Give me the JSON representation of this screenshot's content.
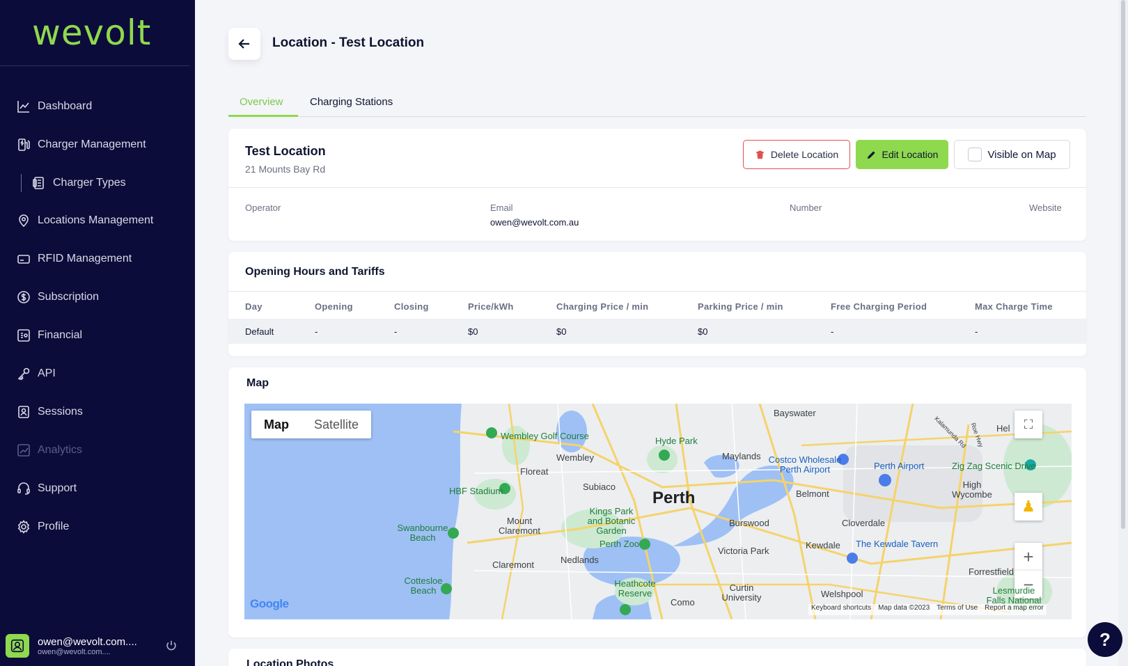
{
  "app": {
    "logo": "wevolt"
  },
  "sidebar": {
    "items": [
      {
        "label": "Dashboard",
        "icon": "chart-line-icon"
      },
      {
        "label": "Charger Management",
        "icon": "charger-icon"
      },
      {
        "label": "Charger Types",
        "icon": "charger-types-icon"
      },
      {
        "label": "Locations Management",
        "icon": "location-pin-icon"
      },
      {
        "label": "RFID Management",
        "icon": "rfid-card-icon"
      },
      {
        "label": "Subscription",
        "icon": "subscription-icon"
      },
      {
        "label": "Financial",
        "icon": "financial-icon"
      },
      {
        "label": "API",
        "icon": "key-icon"
      },
      {
        "label": "Sessions",
        "icon": "sessions-icon"
      },
      {
        "label": "Analytics",
        "icon": "analytics-icon"
      },
      {
        "label": "Support",
        "icon": "headset-icon"
      },
      {
        "label": "Profile",
        "icon": "gear-icon"
      }
    ],
    "user": {
      "name": "owen@wevolt.com....",
      "email": "owen@wevolt.com...."
    }
  },
  "header": {
    "title": "Location - Test Location"
  },
  "tabs": [
    {
      "label": "Overview"
    },
    {
      "label": "Charging Stations"
    }
  ],
  "location": {
    "name": "Test Location",
    "address": "21 Mounts Bay Rd",
    "buttons": {
      "delete": "Delete Location",
      "edit": "Edit Location",
      "visible": "Visible on Map"
    },
    "fields": {
      "operator_label": "Operator",
      "email_label": "Email",
      "email_value": "owen@wevolt.com.au",
      "number_label": "Number",
      "website_label": "Website"
    }
  },
  "hours": {
    "title": "Opening Hours and Tariffs",
    "columns": [
      "Day",
      "Opening",
      "Closing",
      "Price/kWh",
      "Charging Price / min",
      "Parking Price / min",
      "Free Charging Period",
      "Max Charge Time"
    ],
    "rows": [
      [
        "Default",
        "-",
        "-",
        "$0",
        "$0",
        "$0",
        "-",
        "-"
      ]
    ]
  },
  "map": {
    "title": "Map",
    "toggle": {
      "map": "Map",
      "satellite": "Satellite"
    },
    "places": {
      "perth": "Perth",
      "bayswater": "Bayswater",
      "hyde_park": "Hyde Park",
      "maylands": "Maylands",
      "wembley_golf": "Wembley Golf Course",
      "wembley": "Wembley",
      "floreat": "Floreat",
      "subiaco": "Subiaco",
      "hbf": "HBF Stadium",
      "mount_claremont": "Mount Claremont",
      "swanbourne": "Swanbourne Beach",
      "kings_park": "Kings Park and Botanic Garden",
      "perth_zoo": "Perth Zoo",
      "claremont": "Claremont",
      "nedlands": "Nedlands",
      "cottesloe": "Cottesloe Beach",
      "heathcote": "Heathcote Reserve",
      "como": "Como",
      "curtin": "Curtin University",
      "victoria_park": "Victoria Park",
      "burswood": "Burswood",
      "belmont": "Belmont",
      "cloverdale": "Cloverdale",
      "kewdale": "Kewdale",
      "kewdale_tavern": "The Kewdale Tavern",
      "welshpool": "Welshpool",
      "forrestfield": "Forrestfield",
      "costco": "Costco Wholesale Perth Airport",
      "perth_airport": "Perth Airport",
      "zig_zag": "Zig Zag Scenic Drive",
      "high_wycombe": "High Wycombe",
      "lesmurdie": "Lesmurdie Falls National",
      "hel": "Hel",
      "kalamunda_rd": "Kalamunda Rd",
      "roe_hwy": "Roe Hwy"
    },
    "google": "Google",
    "footer": {
      "shortcuts": "Keyboard shortcuts",
      "data": "Map data ©2023",
      "terms": "Terms of Use",
      "report": "Report a map error"
    }
  },
  "photos": {
    "title": "Location Photos"
  },
  "help": {
    "label": "?"
  }
}
